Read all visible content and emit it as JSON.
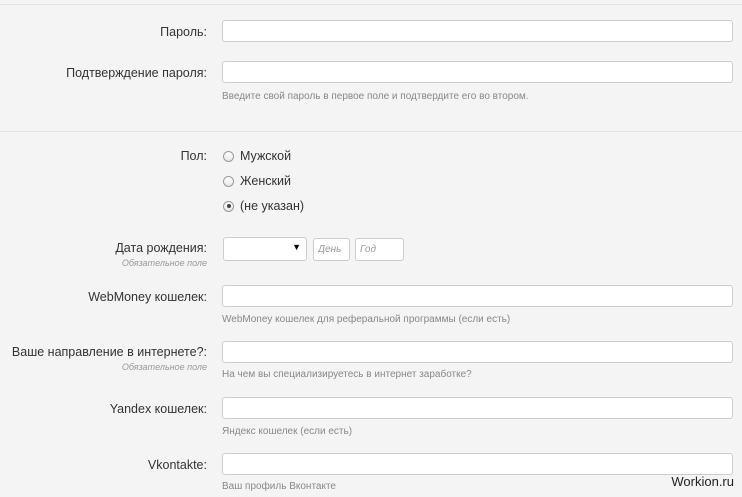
{
  "password": {
    "label": "Пароль:",
    "value": "",
    "placeholder": ""
  },
  "password_confirm": {
    "label": "Подтверждение пароля:",
    "value": "",
    "placeholder": "",
    "hint": "Введите свой пароль в первое поле и подтвердите его во втором."
  },
  "gender": {
    "label": "Пол:",
    "options": [
      "Мужской",
      "Женский",
      "(не указан)"
    ],
    "selected": "(не указан)"
  },
  "birthdate": {
    "label": "Дата рождения:",
    "required": "Обязательное поле",
    "month_value": "",
    "day_placeholder": "День",
    "year_placeholder": "Год"
  },
  "webmoney": {
    "label": "WebMoney кошелек:",
    "value": "",
    "hint": "WebMoney кошелек для реферальной программы (если есть)"
  },
  "direction": {
    "label": "Ваше направление в интернете?:",
    "required": "Обязательное поле",
    "value": "",
    "hint": "На чем вы специализируетесь в интернет заработке?"
  },
  "yandex": {
    "label": "Yandex кошелек:",
    "value": "",
    "hint": "Яндекс кошелек (если есть)"
  },
  "vkontakte": {
    "label": "Vkontakte:",
    "value": "",
    "hint": "Ваш профиль Вконтакте"
  },
  "watermark": "Workion.ru",
  "colors": {
    "background": "#f4f4f4",
    "border": "#cccccc",
    "hint": "#888888"
  }
}
